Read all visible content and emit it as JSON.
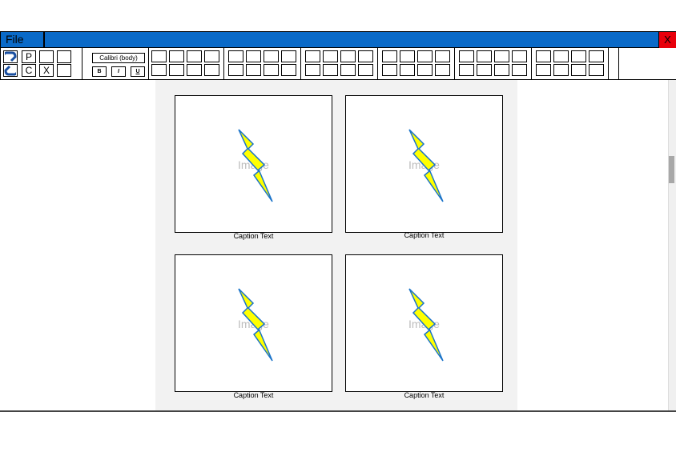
{
  "menu": {
    "file_label": "File",
    "close_label": "X"
  },
  "toolbar": {
    "paste_label": "P",
    "copy_label": "C",
    "cut_label": "X",
    "font_name": "Calibri (body)",
    "bold_label": "B",
    "italic_label": "I",
    "underline_label": "U",
    "icons": [
      "undo-icon",
      "redo-icon"
    ]
  },
  "document": {
    "image_cards": [
      {
        "placeholder": "Image",
        "caption": "Caption Text"
      },
      {
        "placeholder": "Image",
        "caption": "Caption Text"
      },
      {
        "placeholder": "Image",
        "caption": "Caption Text"
      },
      {
        "placeholder": "Image",
        "caption": "Caption Text"
      }
    ]
  },
  "colors": {
    "titlebar": "#0a6ac8",
    "close": "#e8000b",
    "bolt_fill": "#ffff00",
    "bolt_stroke": "#1a73c9",
    "doc_bg": "#f2f2f2"
  }
}
